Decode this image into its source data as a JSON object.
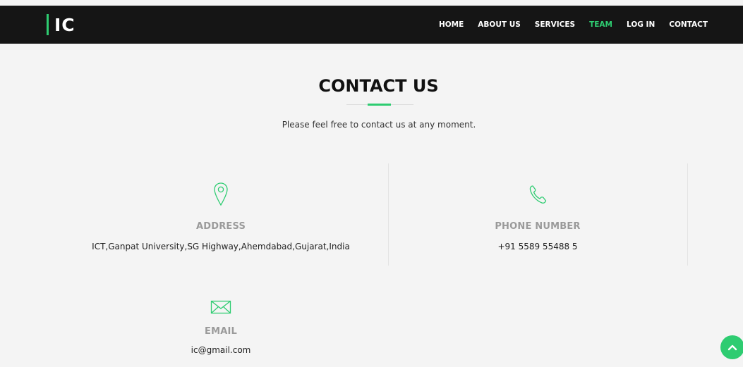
{
  "brand": {
    "logo_text": "IC"
  },
  "nav": {
    "items": [
      {
        "label": "HOME",
        "active": false
      },
      {
        "label": "ABOUT US",
        "active": false
      },
      {
        "label": "SERVICES",
        "active": false
      },
      {
        "label": "TEAM",
        "active": true
      },
      {
        "label": "LOG IN",
        "active": false
      },
      {
        "label": "CONTACT",
        "active": false
      }
    ]
  },
  "contact": {
    "title": "CONTACT US",
    "subtitle": "Please feel free to contact us at any moment.",
    "address": {
      "icon": "map-pin-icon",
      "label": "ADDRESS",
      "value": "ICT,Ganpat University,SG Highway,Ahemdabad,Gujarat,India"
    },
    "phone": {
      "icon": "phone-icon",
      "label": "PHONE NUMBER",
      "value": "+91 5589 55488 5"
    },
    "email": {
      "icon": "mail-icon",
      "label": "EMAIL",
      "value": "ic@gmail.com"
    }
  },
  "colors": {
    "accent": "#2ecc71",
    "navbar": "#151515",
    "background": "#f4f4f4"
  },
  "back_to_top": {
    "icon": "chevron-up-icon"
  }
}
